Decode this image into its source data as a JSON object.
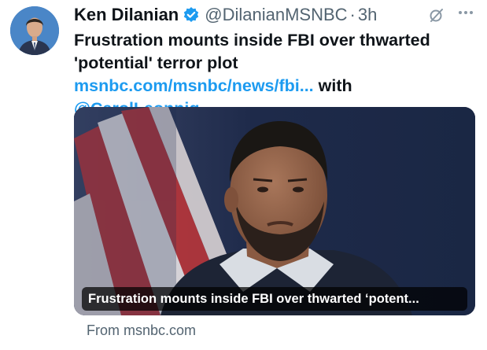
{
  "author": {
    "name": "Ken Dilanian",
    "handle": "@DilanianMSNBC",
    "separator": "·",
    "time": "3h"
  },
  "tweet": {
    "text_before": "Frustration mounts inside FBI over thwarted 'potential' terror plot ",
    "link": "msnbc.com/msnbc/news/fbi...",
    "text_middle": " with ",
    "mention": "@CarolLeonnig"
  },
  "card": {
    "headline": "Frustration mounts inside FBI over thwarted ‘potent...",
    "source": "From msnbc.com"
  },
  "icons": {
    "verified": "verified-badge-icon",
    "grok": "grok-icon",
    "more": "more-icon"
  },
  "colors": {
    "link": "#1d9bf0",
    "verified": "#1d9bf0",
    "secondary_text": "#536471"
  }
}
